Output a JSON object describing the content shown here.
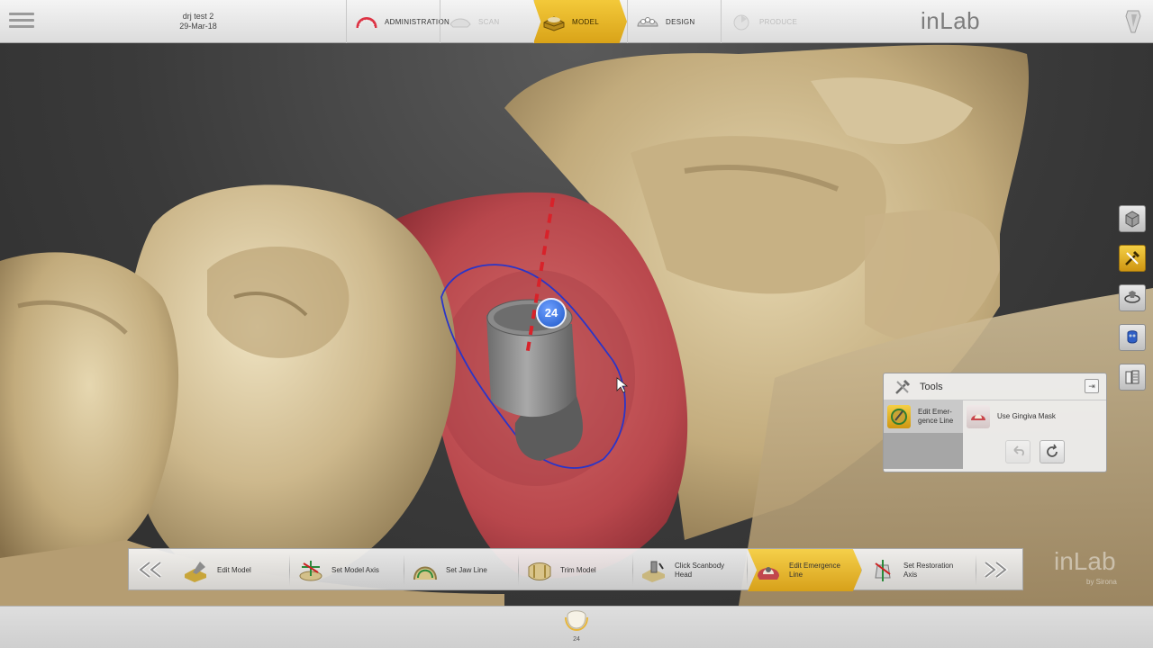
{
  "case": {
    "name": "drj test 2",
    "date": "29-Mar-18"
  },
  "phases": [
    {
      "label": "ADMINISTRATION",
      "state": "normal",
      "icon": "dental-arch-icon"
    },
    {
      "label": "SCAN",
      "state": "disabled",
      "icon": "scan-icon"
    },
    {
      "label": "MODEL",
      "state": "active",
      "icon": "model-icon"
    },
    {
      "label": "DESIGN",
      "state": "normal",
      "icon": "design-icon"
    },
    {
      "label": "PRODUCE",
      "state": "disabled",
      "icon": "produce-icon"
    }
  ],
  "brand": "inLab",
  "watermark": {
    "logo": "inLab",
    "sub": "by Sirona"
  },
  "viewport": {
    "tooth_label": "24"
  },
  "right_toolbar": [
    {
      "name": "view-cube-icon",
      "active": false
    },
    {
      "name": "tools-icon",
      "active": true
    },
    {
      "name": "rotate-view-icon",
      "active": false
    },
    {
      "name": "object-list-icon",
      "active": false
    },
    {
      "name": "library-icon",
      "active": false
    }
  ],
  "tools_panel": {
    "title": "Tools",
    "items": [
      {
        "label_line1": "Edit Emer-",
        "label_line2": "gence Line",
        "selected": true,
        "icon": "emergence-line-icon"
      },
      {
        "label_line1": "Use Gingiva Mask",
        "label_line2": "",
        "selected": false,
        "icon": "gingiva-mask-icon"
      }
    ]
  },
  "steps": [
    {
      "label_line1": "Edit Model",
      "label_line2": "",
      "active": false,
      "icon": "edit-model-icon"
    },
    {
      "label_line1": "Set Model Axis",
      "label_line2": "",
      "active": false,
      "icon": "model-axis-icon"
    },
    {
      "label_line1": "Set Jaw Line",
      "label_line2": "",
      "active": false,
      "icon": "jaw-line-icon"
    },
    {
      "label_line1": "Trim Model",
      "label_line2": "",
      "active": false,
      "icon": "trim-model-icon"
    },
    {
      "label_line1": "Click Scanbody",
      "label_line2": "Head",
      "active": false,
      "icon": "scanbody-icon"
    },
    {
      "label_line1": "Edit Emergence",
      "label_line2": "Line",
      "active": true,
      "icon": "emergence-line-icon"
    },
    {
      "label_line1": "Set Restoration",
      "label_line2": "Axis",
      "active": false,
      "icon": "restoration-axis-icon"
    }
  ],
  "bottom": {
    "tooth_tab_label": "24"
  },
  "colors": {
    "accent": "#e0b128",
    "gingiva": "#b84a4e",
    "model": "#d8c7a0"
  }
}
